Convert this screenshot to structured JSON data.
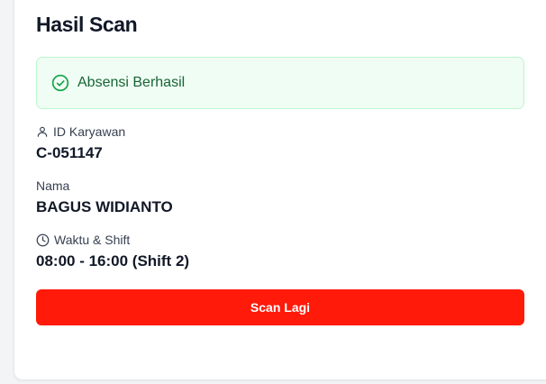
{
  "card": {
    "title": "Hasil Scan"
  },
  "alert": {
    "icon": "check-circle-icon",
    "text": "Absensi Berhasil",
    "color": "#16a34a"
  },
  "fields": {
    "employee_id": {
      "icon": "user-icon",
      "label": "ID Karyawan",
      "value": "C-051147"
    },
    "name": {
      "label": "Nama",
      "value": "BAGUS WIDIANTO"
    },
    "time_shift": {
      "icon": "clock-icon",
      "label": "Waktu & Shift",
      "value": "08:00 - 16:00 (Shift 2)"
    }
  },
  "actions": {
    "scan_again_label": "Scan Lagi",
    "accent": "#ff1a0a"
  }
}
